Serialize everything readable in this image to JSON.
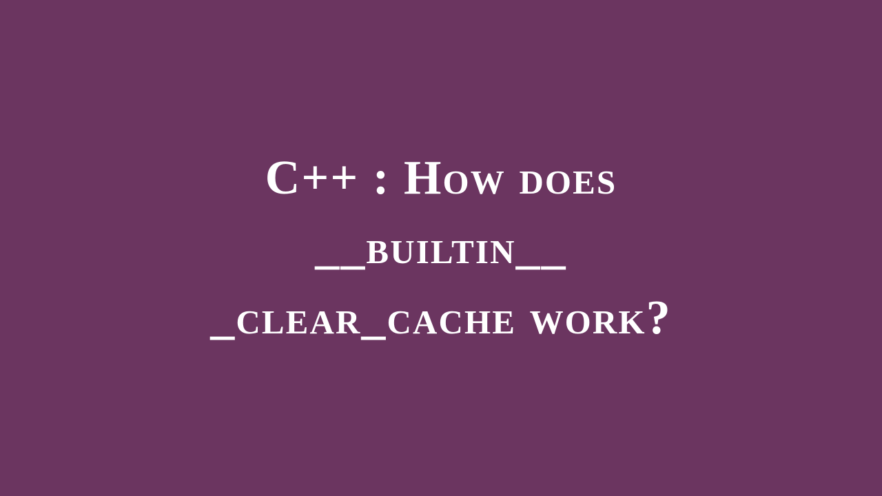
{
  "slide": {
    "line1_prefix": "C++ : ",
    "line1_h": "H",
    "line1_rest": "ow does",
    "line2": "__builtin__",
    "line3": "_clear_cache work?"
  }
}
